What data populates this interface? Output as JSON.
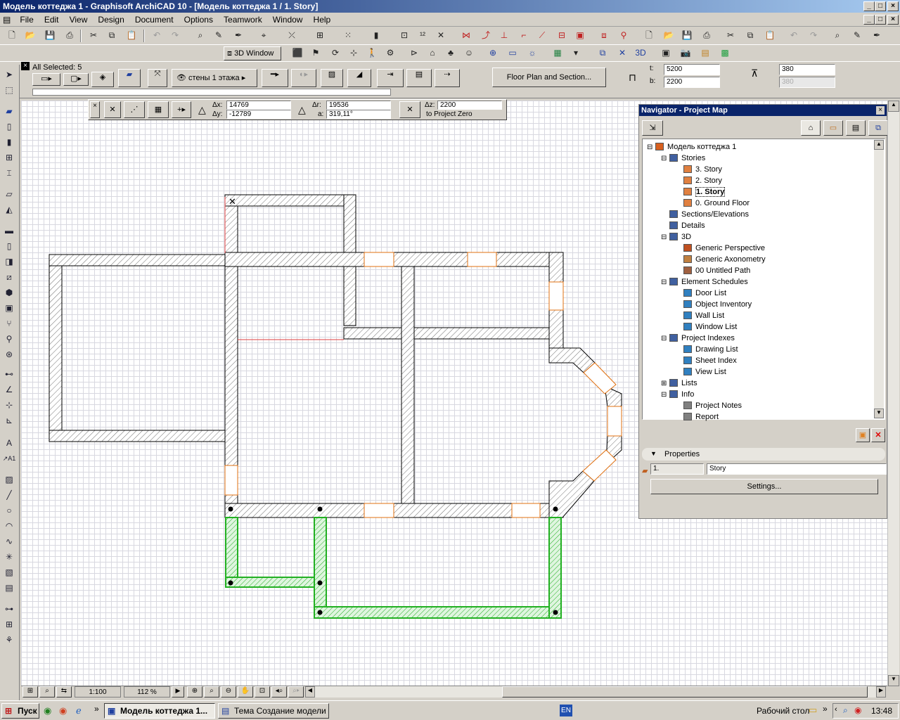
{
  "window": {
    "title": "Модель коттеджа 1 - Graphisoft ArchiCAD 10 - [Модель коттеджа 1 / 1. Story]"
  },
  "menu": [
    "File",
    "Edit",
    "View",
    "Design",
    "Document",
    "Options",
    "Teamwork",
    "Window",
    "Help"
  ],
  "toolbar2": {
    "window3d_label": "3D Window"
  },
  "infobox": {
    "all_selected": "All Selected: 5",
    "layer_combo": "стены 1 этажа",
    "floorplan_button": "Floor Plan and Section...",
    "t_label": "t:",
    "t_value": "5200",
    "b_label": "b:",
    "b_value": "2200",
    "height_value": "380",
    "height_ghost": "380"
  },
  "coord_palette": {
    "dx_label": "Δx:",
    "dx_value": "14769",
    "dy_label": "Δy:",
    "dy_value": "-12789",
    "dr_label": "Δr:",
    "dr_value": "19536",
    "a_label": "a:",
    "a_value": "319,11°",
    "dz_label": "Δz:",
    "dz_value": "2200",
    "zero_label": "to Project Zero"
  },
  "navigator": {
    "title": "Navigator - Project Map",
    "tree": [
      {
        "label": "Модель коттеджа 1",
        "level": 0,
        "expander": "⊟",
        "color": "#d86020"
      },
      {
        "label": "Stories",
        "level": 1,
        "expander": "⊟",
        "color": "#4060a0"
      },
      {
        "label": "3. Story",
        "level": 2,
        "expander": "",
        "color": "#e08040"
      },
      {
        "label": "2. Story",
        "level": 2,
        "expander": "",
        "color": "#e08040"
      },
      {
        "label": "1. Story",
        "level": 2,
        "expander": "",
        "color": "#e08040",
        "selected": true
      },
      {
        "label": "0. Ground Floor",
        "level": 2,
        "expander": "",
        "color": "#e08040"
      },
      {
        "label": "Sections/Elevations",
        "level": 1,
        "expander": "",
        "color": "#4060a0"
      },
      {
        "label": "Details",
        "level": 1,
        "expander": "",
        "color": "#4060a0"
      },
      {
        "label": "3D",
        "level": 1,
        "expander": "⊟",
        "color": "#4060a0"
      },
      {
        "label": "Generic Perspective",
        "level": 2,
        "expander": "",
        "color": "#c05020"
      },
      {
        "label": "Generic Axonometry",
        "level": 2,
        "expander": "",
        "color": "#c08040"
      },
      {
        "label": "00 Untitled Path",
        "level": 2,
        "expander": "",
        "color": "#a06040"
      },
      {
        "label": "Element Schedules",
        "level": 1,
        "expander": "⊟",
        "color": "#4060a0"
      },
      {
        "label": "Door List",
        "level": 2,
        "expander": "",
        "color": "#3080c0"
      },
      {
        "label": "Object Inventory",
        "level": 2,
        "expander": "",
        "color": "#3080c0"
      },
      {
        "label": "Wall List",
        "level": 2,
        "expander": "",
        "color": "#3080c0"
      },
      {
        "label": "Window List",
        "level": 2,
        "expander": "",
        "color": "#3080c0"
      },
      {
        "label": "Project Indexes",
        "level": 1,
        "expander": "⊟",
        "color": "#4060a0"
      },
      {
        "label": "Drawing List",
        "level": 2,
        "expander": "",
        "color": "#3080c0"
      },
      {
        "label": "Sheet Index",
        "level": 2,
        "expander": "",
        "color": "#3080c0"
      },
      {
        "label": "View List",
        "level": 2,
        "expander": "",
        "color": "#3080c0"
      },
      {
        "label": "Lists",
        "level": 1,
        "expander": "⊞",
        "color": "#4060a0"
      },
      {
        "label": "Info",
        "level": 1,
        "expander": "⊟",
        "color": "#4060a0"
      },
      {
        "label": "Project Notes",
        "level": 2,
        "expander": "",
        "color": "#808080"
      },
      {
        "label": "Report",
        "level": 2,
        "expander": "",
        "color": "#808080"
      }
    ],
    "properties_label": "Properties",
    "prop_id": "1.",
    "prop_name": "Story",
    "settings_button": "Settings..."
  },
  "statusbar": {
    "scale": "1:100",
    "zoom": "112 %"
  },
  "taskbar": {
    "start": "Пуск",
    "task1": "Модель коттеджа 1...",
    "task2": "Тема Создание модели ...",
    "lang": "EN",
    "desktop": "Рабочий стол",
    "time": "13:48"
  },
  "colors": {
    "selection_green": "#22b022",
    "opening_orange": "#e07010",
    "wall_hatch": "#606060"
  }
}
